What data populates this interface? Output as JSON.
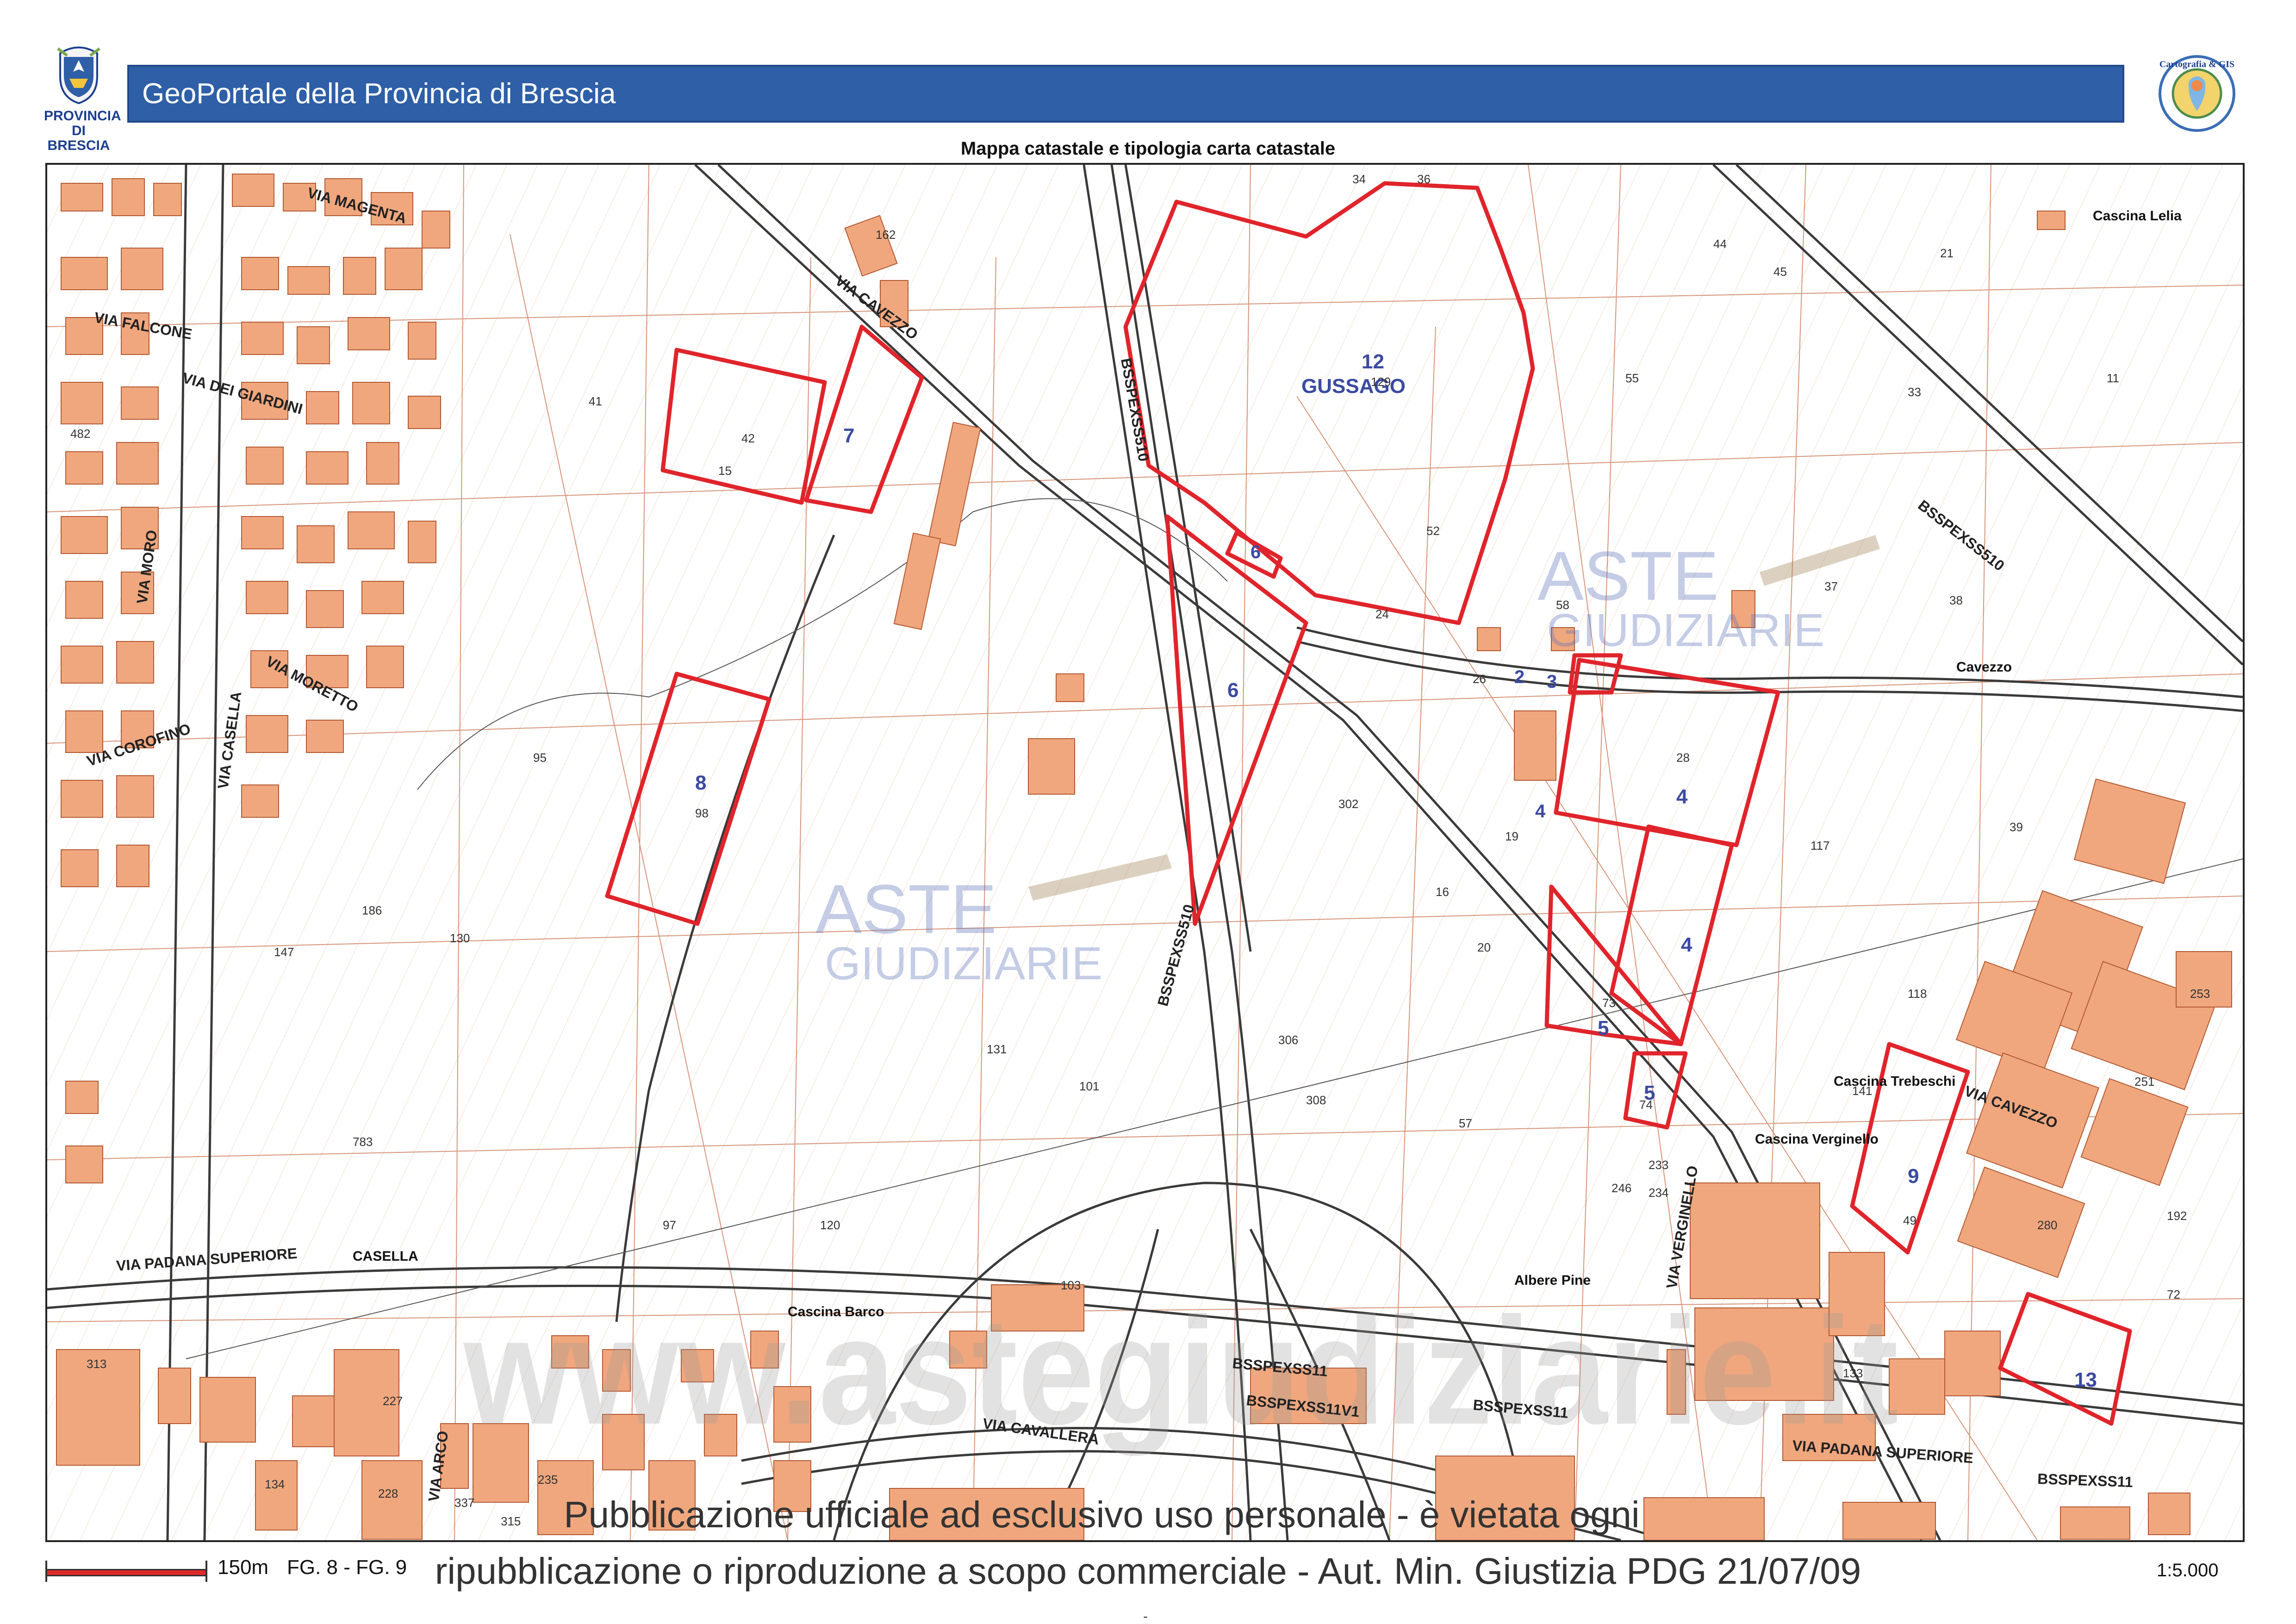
{
  "header": {
    "title": "GeoPortale della Provincia di Brescia",
    "left_logo_text": "PROVINCIA DI BRESCIA",
    "right_logo_text": "Cartografia & GIS",
    "bar_color": "#2e5fa7"
  },
  "map": {
    "title": "Mappa catastale e tipologia carta catastale",
    "colors": {
      "parcel_border": "#e0242b",
      "building": "#f0a77e",
      "building_stroke": "#b35a33",
      "label": "#3b4aa0"
    },
    "watermark_main": "ASTE",
    "watermark_sub": "GIUDIZIARIE",
    "watermark_url": "www.astegiudiziarie.it",
    "places": {
      "gussago": "GUSSAGO",
      "cascina_lelia": "Cascina Lelia",
      "cavezzo": "Cavezzo",
      "cascina_trebeschi": "Cascina Trebeschi",
      "cascina_verginello": "Cascina Verginello",
      "albere_pine": "Albere Pine",
      "cascina_barco": "Cascina Barco",
      "casella": "CASELLA"
    },
    "roads": {
      "via_padana_superiore": "VIA PADANA SUPERIORE",
      "via_padana_superiore_east": "VIA PADANA SUPERIORE",
      "via_cavallera": "VIA CAVALLERA",
      "via_cavezzo_n": "VIA CAVEZZO",
      "via_cavezzo_e": "VIA CAVEZZO",
      "via_verginello": "VIA VERGINELLO",
      "via_moretto": "VIA MORETTO",
      "via_corofino": "VIA COROFINO",
      "via_magenta": "VIA MAGENTA",
      "via_dei_giardini": "VIA DEI GIARDINI",
      "via_casella": "VIA CASELLA",
      "via_moro": "VIA MORO",
      "via_falcone": "VIA FALCONE",
      "via_arco": "VIA ARCO",
      "bssp_n": "BSSPEXSS510",
      "bssp_mid": "BSSPEXSS510",
      "bssp_e": "BSSPEXSS510",
      "bssp_s1": "BSSPEXSS11",
      "bssp_s2": "BSSPEXSS11",
      "bssp_s3": "BSSPEXSS11V1",
      "bssp_se": "BSSPEXSS11"
    },
    "lots": {
      "lot12": "12",
      "lot7": "7",
      "lot6a": "6",
      "lot6b": "6",
      "lot8": "8",
      "lot2": "2",
      "lot3": "3",
      "lot4a": "4",
      "lot4b": "4",
      "lot4c": "4",
      "lot5a": "5",
      "lot5b": "5",
      "lot9": "9",
      "lot13": "13"
    },
    "parcel_numbers": {
      "p_gussago": "129",
      "p34": "34",
      "p36": "36",
      "p52": "52",
      "p28": "28",
      "p42": "42",
      "p15": "15",
      "p41": "41",
      "p95": "95",
      "p98": "98",
      "p186": "186",
      "p147": "147",
      "p130": "130",
      "p783": "783",
      "p302": "302",
      "p306": "306",
      "p308": "308",
      "p246": "246",
      "p57": "57",
      "p44": "44",
      "p45": "45",
      "p55": "55",
      "p37": "37",
      "p38": "38",
      "p253": "253",
      "p251": "251",
      "p280": "280",
      "p192": "192",
      "p72": "72",
      "p133": "133",
      "p103": "103",
      "p313": "313",
      "p227": "227",
      "p228": "228",
      "p134": "134",
      "p235": "235",
      "p315": "315",
      "p337": "337",
      "p162": "162",
      "p482": "482",
      "p120": "120",
      "p97": "97",
      "p101": "101",
      "p131": "131",
      "p21": "21",
      "p11": "11",
      "p33": "33",
      "p117": "117",
      "p118": "118",
      "p39": "39",
      "p141": "141",
      "p49": "49",
      "p233": "233",
      "p234": "234",
      "p74": "74",
      "p73": "73",
      "p26": "26",
      "p24": "24",
      "p16": "16",
      "p19": "19",
      "p20": "20",
      "p58": "58"
    }
  },
  "footer": {
    "scale_label": "150m",
    "sheets": "FG. 8 - FG. 9",
    "ratio": "1:5.000",
    "notice_line1": "Pubblicazione ufficiale ad esclusivo uso personale - è vietata ogni",
    "notice_line2": "ripubblicazione o riproduzione a scopo commerciale - Aut. Min. Giustizia PDG 21/07/09",
    "dash": "-"
  }
}
